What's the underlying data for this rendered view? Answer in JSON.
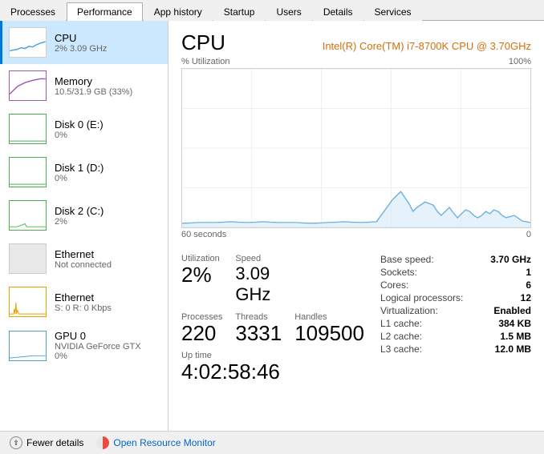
{
  "tabs": [
    {
      "label": "Processes",
      "active": false
    },
    {
      "label": "Performance",
      "active": true
    },
    {
      "label": "App history",
      "active": false
    },
    {
      "label": "Startup",
      "active": false
    },
    {
      "label": "Users",
      "active": false
    },
    {
      "label": "Details",
      "active": false
    },
    {
      "label": "Services",
      "active": false
    }
  ],
  "sidebar": {
    "items": [
      {
        "id": "cpu",
        "title": "CPU",
        "subtitle": "2% 3.09 GHz",
        "active": true
      },
      {
        "id": "memory",
        "title": "Memory",
        "subtitle": "10.5/31.9 GB (33%)",
        "active": false
      },
      {
        "id": "disk0",
        "title": "Disk 0 (E:)",
        "subtitle": "0%",
        "active": false
      },
      {
        "id": "disk1",
        "title": "Disk 1 (D:)",
        "subtitle": "0%",
        "active": false
      },
      {
        "id": "disk2",
        "title": "Disk 2 (C:)",
        "subtitle": "2%",
        "active": false
      },
      {
        "id": "ethernet0",
        "title": "Ethernet",
        "subtitle": "Not connected",
        "active": false
      },
      {
        "id": "ethernet1",
        "title": "Ethernet",
        "subtitle": "S: 0 R: 0 Kbps",
        "active": false
      },
      {
        "id": "gpu0",
        "title": "GPU 0",
        "subtitle": "NVIDIA GeForce GTX",
        "subtitle2": "0%",
        "active": false
      }
    ]
  },
  "panel": {
    "title": "CPU",
    "cpu_model": "Intel(R) Core(TM) i7-8700K CPU @ 3.70GHz",
    "chart_label_left": "% Utilization",
    "chart_label_right": "100%",
    "chart_time_left": "60 seconds",
    "chart_time_right": "0",
    "stats": {
      "utilization_label": "Utilization",
      "utilization_value": "2%",
      "speed_label": "Speed",
      "speed_value": "3.09 GHz",
      "processes_label": "Processes",
      "processes_value": "220",
      "threads_label": "Threads",
      "threads_value": "3331",
      "handles_label": "Handles",
      "handles_value": "109500",
      "uptime_label": "Up time",
      "uptime_value": "4:02:58:46"
    },
    "info": {
      "base_speed_label": "Base speed:",
      "base_speed_value": "3.70 GHz",
      "sockets_label": "Sockets:",
      "sockets_value": "1",
      "cores_label": "Cores:",
      "cores_value": "6",
      "logical_label": "Logical processors:",
      "logical_value": "12",
      "virtualization_label": "Virtualization:",
      "virtualization_value": "Enabled",
      "l1_label": "L1 cache:",
      "l1_value": "384 KB",
      "l2_label": "L2 cache:",
      "l2_value": "1.5 MB",
      "l3_label": "L3 cache:",
      "l3_value": "12.0 MB"
    }
  },
  "footer": {
    "fewer_details_label": "Fewer details",
    "open_monitor_label": "Open Resource Monitor"
  }
}
